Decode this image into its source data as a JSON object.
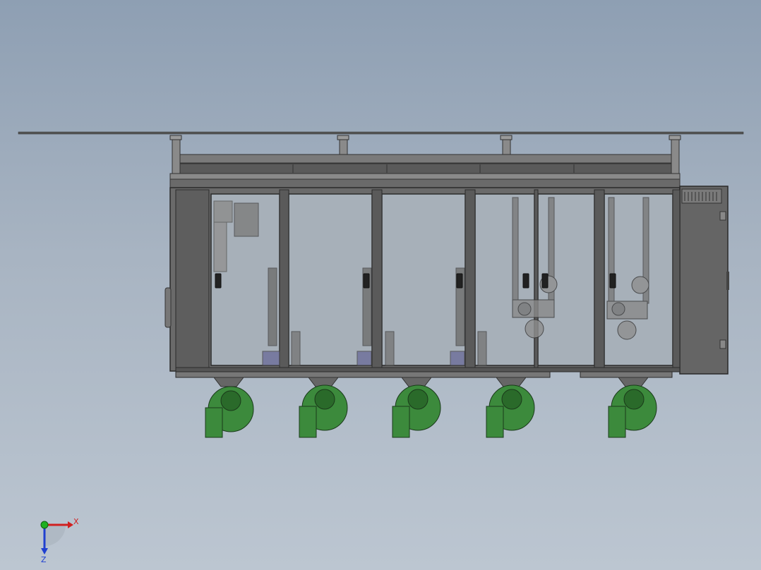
{
  "viewport": {
    "background_top": "#8e9fb3",
    "background_bottom": "#bcc6d1"
  },
  "model": {
    "frame_color": "#5c5c5c",
    "panel_color": "#6e6e6e",
    "glass_color": "#a7b0b9",
    "fan_color": "#3c8a3c",
    "fan_dark": "#2a6a2a",
    "bays": 5
  },
  "triad": {
    "x_label": "X",
    "z_label": "Z",
    "x_color": "#d02020",
    "y_color": "#20b020",
    "z_color": "#2040d0"
  }
}
